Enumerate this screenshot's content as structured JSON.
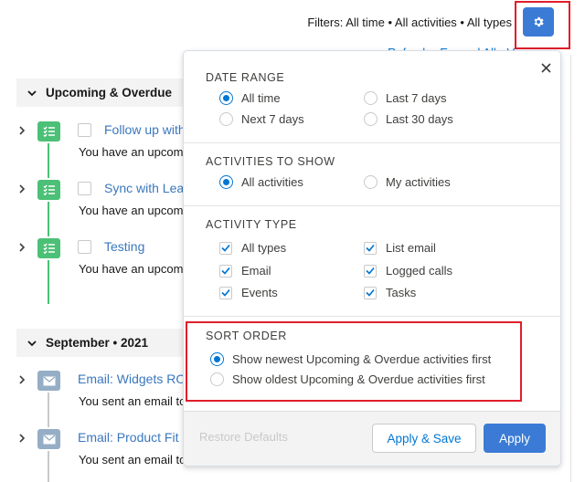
{
  "header": {
    "filters_text": "Filters: All time • All activities • All types",
    "links_text": "Refresh • Expand All • View All"
  },
  "sections": {
    "upcoming_title": "Upcoming & Overdue",
    "september_title": "September • 2021"
  },
  "upcoming_rows": [
    {
      "title": "Follow up with",
      "desc": "You have an upcoming"
    },
    {
      "title": "Sync with Lea",
      "desc": "You have an upcoming"
    },
    {
      "title": "Testing",
      "desc": "You have an upcoming"
    }
  ],
  "september_rows": [
    {
      "title": "Email: Widgets RO",
      "desc": "You sent an email to"
    },
    {
      "title": "Email: Product Fit",
      "desc": "You sent an email to"
    }
  ],
  "popover": {
    "date_range": {
      "title": "DATE RANGE",
      "options": [
        "All time",
        "Last 7 days",
        "Next 7 days",
        "Last 30 days"
      ],
      "selected": "All time"
    },
    "activities": {
      "title": "ACTIVITIES TO SHOW",
      "options": [
        "All activities",
        "My activities"
      ],
      "selected": "All activities"
    },
    "activity_type": {
      "title": "ACTIVITY TYPE",
      "options": [
        "All types",
        "List email",
        "Email",
        "Logged calls",
        "Events",
        "Tasks"
      ]
    },
    "sort_order": {
      "title": "SORT ORDER",
      "options": [
        "Show newest Upcoming & Overdue activities first",
        "Show oldest Upcoming & Overdue activities first"
      ],
      "selected": "Show newest Upcoming & Overdue activities first"
    },
    "footer": {
      "restore_label": "Restore Defaults",
      "apply_save_label": "Apply & Save",
      "apply_label": "Apply"
    }
  },
  "icons": {
    "gear": "gear-icon",
    "close": "close-icon",
    "task": "task-icon",
    "email": "email-icon",
    "chevron_down": "chevron-down-icon",
    "chevron_right": "chevron-right-icon",
    "checkmark": "checkmark-icon"
  },
  "colors": {
    "brand_blue": "#0176d3",
    "button_blue": "#3b7bd6",
    "task_green": "#4bc076",
    "email_gray_blue": "#95aec5",
    "highlight_red": "#e01e2b"
  }
}
